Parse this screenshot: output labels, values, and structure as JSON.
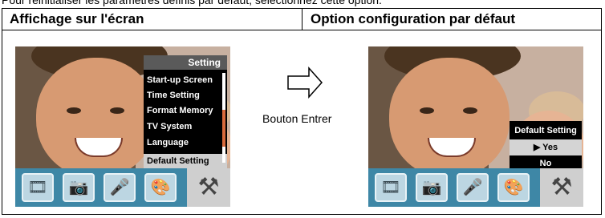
{
  "intro_text": "Pour réinitialiser les paramètres définis par défaut, sélectionnez cette option.",
  "table": {
    "header_left": "Affichage sur l'écran",
    "header_right": "Option configuration par défaut"
  },
  "screen_left": {
    "menu_title": "Setting",
    "items": [
      "Start-up Screen",
      "Time Setting",
      "Format Memory",
      "TV System",
      "Language",
      "Default Setting"
    ],
    "selected_index": 5,
    "scroll_position": 0.6
  },
  "screen_right": {
    "dialog_title": "Default Setting",
    "options": [
      "▶ Yes",
      "No"
    ],
    "selected_index": 0
  },
  "arrow_caption": "Bouton Entrer",
  "bottom_icons": [
    "film-reel-icon",
    "camera-icon",
    "microphone-icon",
    "palette-icon",
    "tools-icon"
  ],
  "colors": {
    "icon_bar": "#3e87a6",
    "menu_bg": "#000000",
    "menu_selected": "#cfcfcf",
    "scrollbar_thumb": "#d86a3c"
  }
}
